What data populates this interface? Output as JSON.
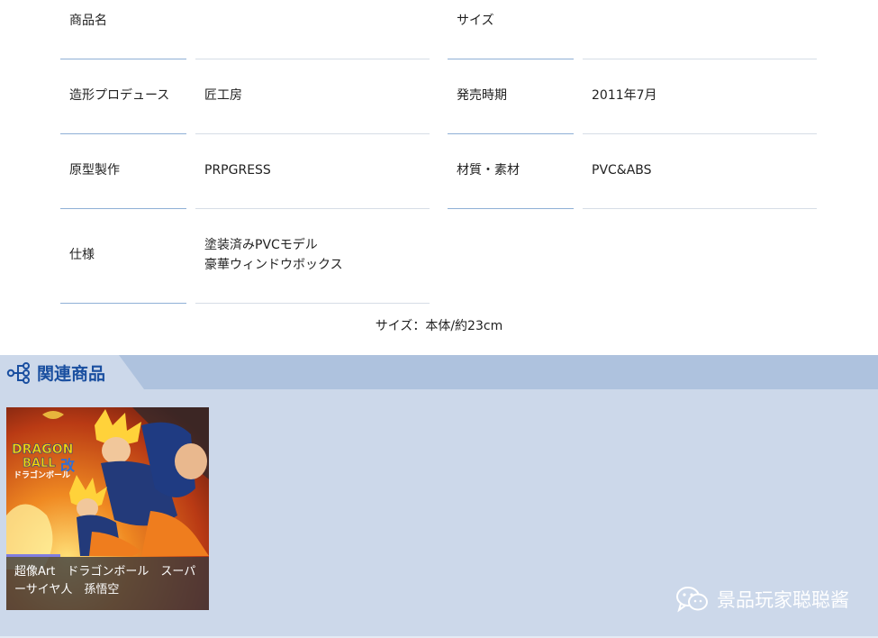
{
  "spec": {
    "rows": [
      {
        "label1": "商品名",
        "value1": "",
        "label2": "サイズ",
        "value2": ""
      },
      {
        "label1": "造形プロデュース",
        "value1": "匠工房",
        "label2": "発売時期",
        "value2": "2011年7月"
      },
      {
        "label1": "原型製作",
        "value1": "PRPGRESS",
        "label2": "材質・素材",
        "value2": "PVC&ABS"
      },
      {
        "label1": "仕様",
        "value1_line1": "塗装済みPVCモデル",
        "value1_line2": "豪華ウィンドウボックス"
      }
    ],
    "size_note": "サイズ：本体/約23cm"
  },
  "related": {
    "title": "関連商品",
    "items": [
      {
        "caption_line1": "超像Art　ドラゴンボール　スーパ",
        "caption_line2": "ーサイヤ人　孫悟空",
        "art_lines": [
          "DRAGON",
          "BALL",
          "改",
          "ドラゴンボール"
        ]
      }
    ]
  },
  "watermark": {
    "text": "景品玩家聪聪酱",
    "icon": "wechat-icon"
  },
  "colors": {
    "accent": "#1a4fa0",
    "section_bg": "#ccd8ea",
    "header_bg": "#aec2de"
  }
}
